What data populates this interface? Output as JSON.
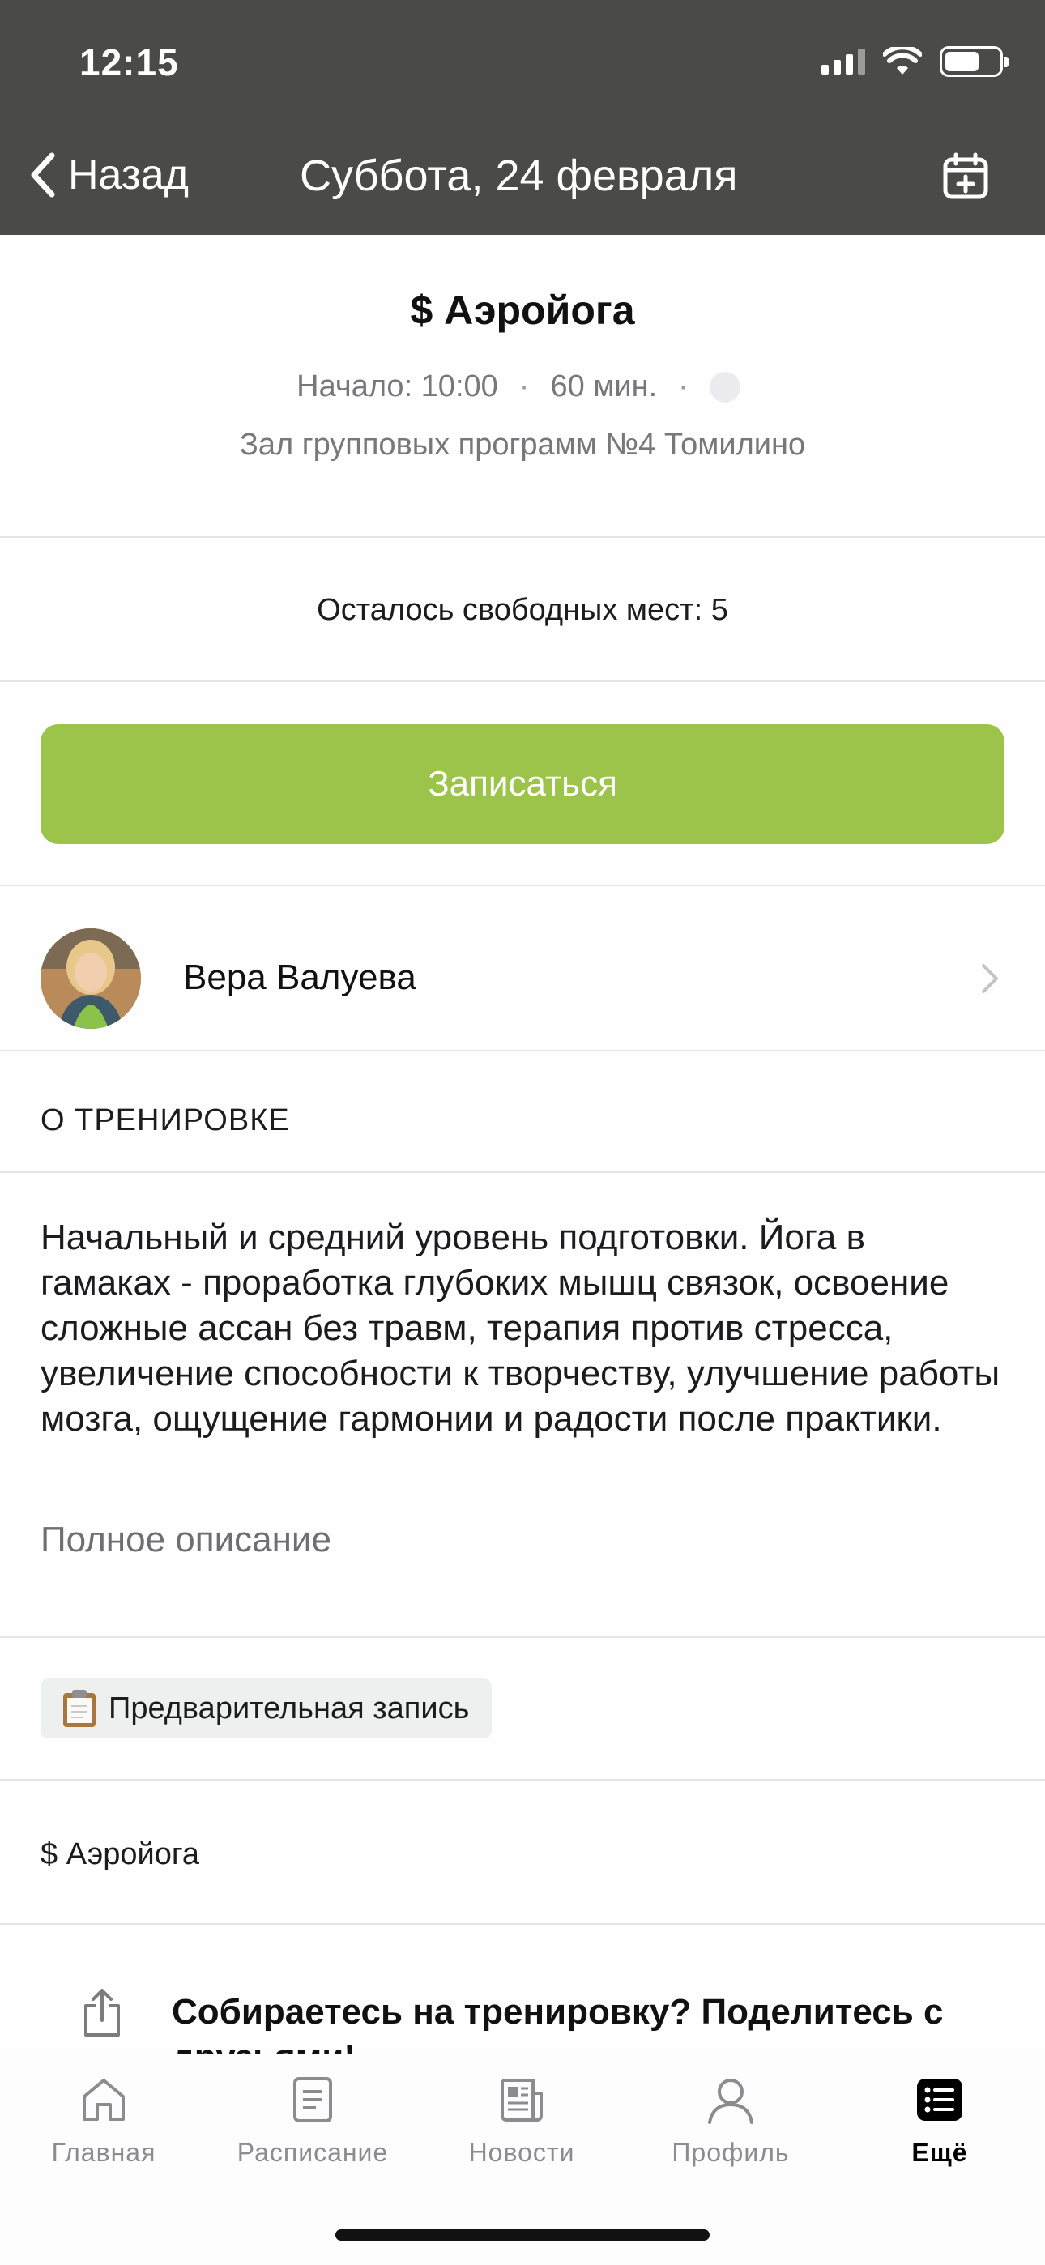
{
  "status_bar": {
    "time": "12:15"
  },
  "nav": {
    "back_label": "Назад",
    "title": "Суббота, 24 февраля",
    "calendar_icon": "calendar-plus-icon"
  },
  "session": {
    "title": "$ Аэройога",
    "start": "Начало: 10:00",
    "separator": "·",
    "duration": "60 мин.",
    "hall": "Зал групповых программ №4 Томилино"
  },
  "places": {
    "text": "Осталось свободных мест: 5"
  },
  "signup": {
    "label": "Записаться",
    "color": "#9cc34a"
  },
  "trainer": {
    "name": "Вера Валуева",
    "avatar_icon": "trainer-avatar"
  },
  "about": {
    "heading": "О ТРЕНИРОВКЕ",
    "description": "Начальный и средний уровень подготовки. Йога в гамаках - проработка глубоких мышц связок, освоение сложные ассан без травм, терапия против стресса, увеличение способности к творчеству, улучшение работы мозга, ощущение гармонии и радости после практики.",
    "full_link": "Полное описание"
  },
  "tag": {
    "label": "Предварительная запись",
    "icon": "clipboard-icon"
  },
  "product": {
    "label": "$ Аэройога"
  },
  "share": {
    "text": "Собираетесь на тренировку? Поделитесь с друзьями!"
  },
  "tabs": [
    {
      "label": "Главная",
      "icon": "home-icon",
      "active": false
    },
    {
      "label": "Расписание",
      "icon": "schedule-icon",
      "active": false
    },
    {
      "label": "Новости",
      "icon": "news-icon",
      "active": false
    },
    {
      "label": "Профиль",
      "icon": "profile-icon",
      "active": false
    },
    {
      "label": "Ещё",
      "icon": "more-icon",
      "active": true
    }
  ]
}
